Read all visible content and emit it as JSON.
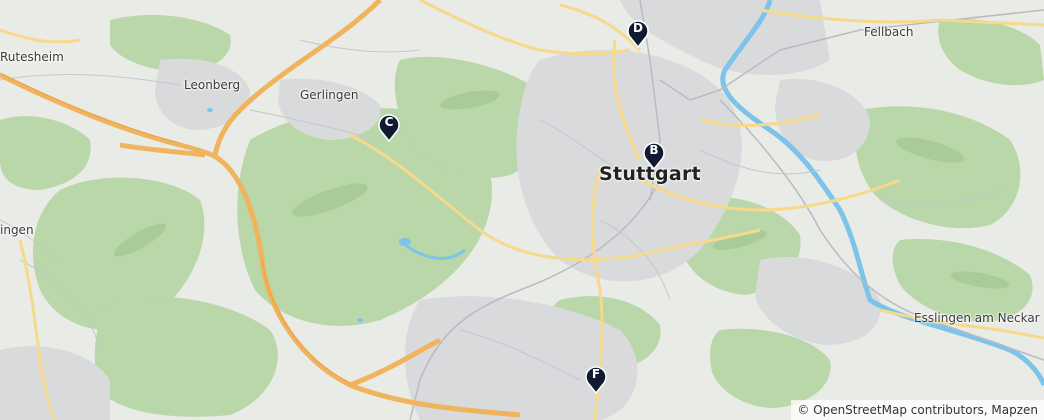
{
  "places": {
    "rutesheim": "Rutesheim",
    "leonberg": "Leonberg",
    "gerlingen": "Gerlingen",
    "stuttgart": "Stuttgart",
    "fellbach": "Fellbach",
    "ingen": "ingen",
    "esslingen": "Esslingen am Neckar"
  },
  "markers": {
    "b": "B",
    "c": "C",
    "d": "D",
    "f": "F"
  },
  "attribution": "© OpenStreetMap contributors, Mapzen",
  "colors": {
    "background": "#e9ebe7",
    "forest": "#b9d7a8",
    "urban": "#d8dadc",
    "motorway": "#f1b45e",
    "primary_road": "#f6d98a",
    "water": "#7ec4ea",
    "marker": "#101a33"
  }
}
